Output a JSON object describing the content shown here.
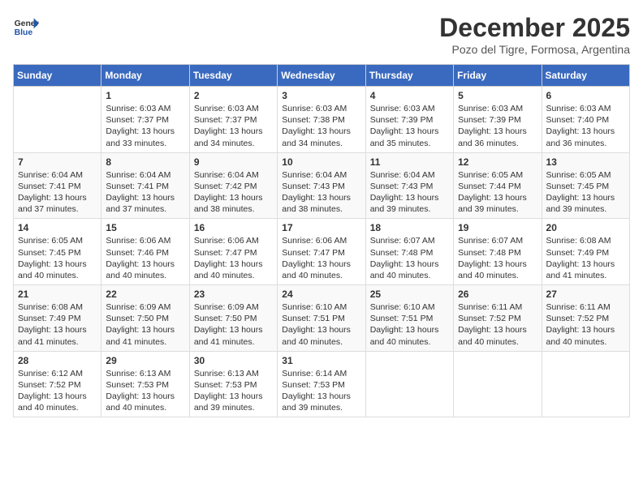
{
  "header": {
    "logo_line1": "General",
    "logo_line2": "Blue",
    "month": "December 2025",
    "location": "Pozo del Tigre, Formosa, Argentina"
  },
  "days_of_week": [
    "Sunday",
    "Monday",
    "Tuesday",
    "Wednesday",
    "Thursday",
    "Friday",
    "Saturday"
  ],
  "weeks": [
    [
      {
        "num": "",
        "info": ""
      },
      {
        "num": "1",
        "info": "Sunrise: 6:03 AM\nSunset: 7:37 PM\nDaylight: 13 hours\nand 33 minutes."
      },
      {
        "num": "2",
        "info": "Sunrise: 6:03 AM\nSunset: 7:37 PM\nDaylight: 13 hours\nand 34 minutes."
      },
      {
        "num": "3",
        "info": "Sunrise: 6:03 AM\nSunset: 7:38 PM\nDaylight: 13 hours\nand 34 minutes."
      },
      {
        "num": "4",
        "info": "Sunrise: 6:03 AM\nSunset: 7:39 PM\nDaylight: 13 hours\nand 35 minutes."
      },
      {
        "num": "5",
        "info": "Sunrise: 6:03 AM\nSunset: 7:39 PM\nDaylight: 13 hours\nand 36 minutes."
      },
      {
        "num": "6",
        "info": "Sunrise: 6:03 AM\nSunset: 7:40 PM\nDaylight: 13 hours\nand 36 minutes."
      }
    ],
    [
      {
        "num": "7",
        "info": "Sunrise: 6:04 AM\nSunset: 7:41 PM\nDaylight: 13 hours\nand 37 minutes."
      },
      {
        "num": "8",
        "info": "Sunrise: 6:04 AM\nSunset: 7:41 PM\nDaylight: 13 hours\nand 37 minutes."
      },
      {
        "num": "9",
        "info": "Sunrise: 6:04 AM\nSunset: 7:42 PM\nDaylight: 13 hours\nand 38 minutes."
      },
      {
        "num": "10",
        "info": "Sunrise: 6:04 AM\nSunset: 7:43 PM\nDaylight: 13 hours\nand 38 minutes."
      },
      {
        "num": "11",
        "info": "Sunrise: 6:04 AM\nSunset: 7:43 PM\nDaylight: 13 hours\nand 39 minutes."
      },
      {
        "num": "12",
        "info": "Sunrise: 6:05 AM\nSunset: 7:44 PM\nDaylight: 13 hours\nand 39 minutes."
      },
      {
        "num": "13",
        "info": "Sunrise: 6:05 AM\nSunset: 7:45 PM\nDaylight: 13 hours\nand 39 minutes."
      }
    ],
    [
      {
        "num": "14",
        "info": "Sunrise: 6:05 AM\nSunset: 7:45 PM\nDaylight: 13 hours\nand 40 minutes."
      },
      {
        "num": "15",
        "info": "Sunrise: 6:06 AM\nSunset: 7:46 PM\nDaylight: 13 hours\nand 40 minutes."
      },
      {
        "num": "16",
        "info": "Sunrise: 6:06 AM\nSunset: 7:47 PM\nDaylight: 13 hours\nand 40 minutes."
      },
      {
        "num": "17",
        "info": "Sunrise: 6:06 AM\nSunset: 7:47 PM\nDaylight: 13 hours\nand 40 minutes."
      },
      {
        "num": "18",
        "info": "Sunrise: 6:07 AM\nSunset: 7:48 PM\nDaylight: 13 hours\nand 40 minutes."
      },
      {
        "num": "19",
        "info": "Sunrise: 6:07 AM\nSunset: 7:48 PM\nDaylight: 13 hours\nand 40 minutes."
      },
      {
        "num": "20",
        "info": "Sunrise: 6:08 AM\nSunset: 7:49 PM\nDaylight: 13 hours\nand 41 minutes."
      }
    ],
    [
      {
        "num": "21",
        "info": "Sunrise: 6:08 AM\nSunset: 7:49 PM\nDaylight: 13 hours\nand 41 minutes."
      },
      {
        "num": "22",
        "info": "Sunrise: 6:09 AM\nSunset: 7:50 PM\nDaylight: 13 hours\nand 41 minutes."
      },
      {
        "num": "23",
        "info": "Sunrise: 6:09 AM\nSunset: 7:50 PM\nDaylight: 13 hours\nand 41 minutes."
      },
      {
        "num": "24",
        "info": "Sunrise: 6:10 AM\nSunset: 7:51 PM\nDaylight: 13 hours\nand 40 minutes."
      },
      {
        "num": "25",
        "info": "Sunrise: 6:10 AM\nSunset: 7:51 PM\nDaylight: 13 hours\nand 40 minutes."
      },
      {
        "num": "26",
        "info": "Sunrise: 6:11 AM\nSunset: 7:52 PM\nDaylight: 13 hours\nand 40 minutes."
      },
      {
        "num": "27",
        "info": "Sunrise: 6:11 AM\nSunset: 7:52 PM\nDaylight: 13 hours\nand 40 minutes."
      }
    ],
    [
      {
        "num": "28",
        "info": "Sunrise: 6:12 AM\nSunset: 7:52 PM\nDaylight: 13 hours\nand 40 minutes."
      },
      {
        "num": "29",
        "info": "Sunrise: 6:13 AM\nSunset: 7:53 PM\nDaylight: 13 hours\nand 40 minutes."
      },
      {
        "num": "30",
        "info": "Sunrise: 6:13 AM\nSunset: 7:53 PM\nDaylight: 13 hours\nand 39 minutes."
      },
      {
        "num": "31",
        "info": "Sunrise: 6:14 AM\nSunset: 7:53 PM\nDaylight: 13 hours\nand 39 minutes."
      },
      {
        "num": "",
        "info": ""
      },
      {
        "num": "",
        "info": ""
      },
      {
        "num": "",
        "info": ""
      }
    ]
  ]
}
